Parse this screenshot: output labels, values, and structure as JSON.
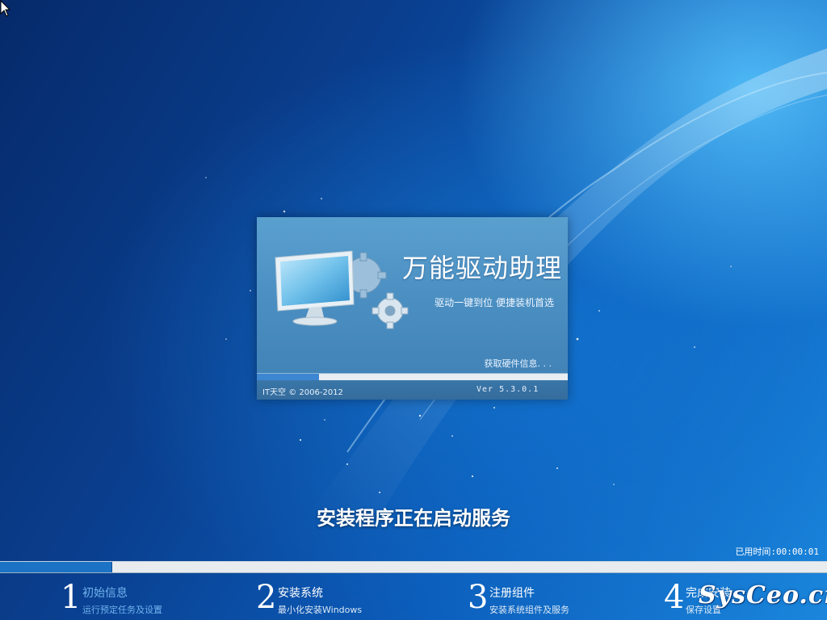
{
  "splash": {
    "title": "万能驱动助理",
    "subtitle": "驱动一键到位 便捷装机首选",
    "status": "获取硬件信息. . .",
    "progress": 0.2,
    "copyright": "IT天空 © 2006-2012",
    "version": "Ver 5.3.0.1"
  },
  "main_status": "安装程序正在启动服务",
  "elapsed": {
    "label": "已用时间:",
    "value": "00:00:01"
  },
  "progress": 0.135,
  "steps": [
    {
      "number": "1",
      "title": "初始信息",
      "desc": "运行预定任务及设置",
      "active": true
    },
    {
      "number": "2",
      "title": "安装系统",
      "desc": "最小化安装Windows",
      "active": false
    },
    {
      "number": "3",
      "title": "注册组件",
      "desc": "安装系统组件及服务",
      "active": false
    },
    {
      "number": "4",
      "title": "完成安装",
      "desc": "保存设置",
      "active": false
    }
  ],
  "watermark": "SysCeo.cn",
  "icons": [
    "cursor-arrow-icon",
    "monitor-icon",
    "gear-icon"
  ]
}
